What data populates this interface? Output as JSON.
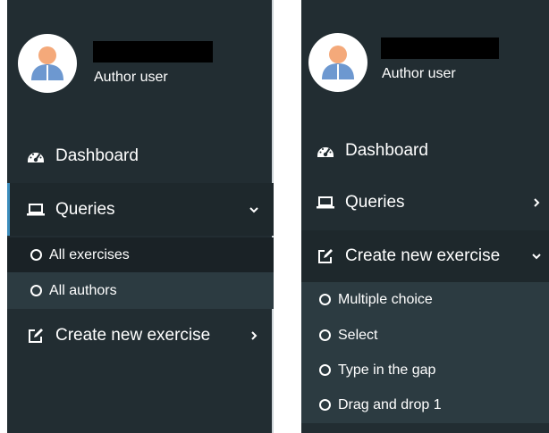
{
  "left_panel": {
    "user": {
      "role": "Author user"
    },
    "nav": {
      "dashboard": "Dashboard",
      "queries": "Queries",
      "queries_children": [
        "All exercises",
        "All authors"
      ],
      "create": "Create new exercise"
    },
    "state": {
      "queries_expanded": true,
      "create_expanded": false
    }
  },
  "right_panel": {
    "user": {
      "role": "Author user"
    },
    "nav": {
      "dashboard": "Dashboard",
      "queries": "Queries",
      "create": "Create new exercise",
      "create_children": [
        "Multiple choice",
        "Select",
        "Type in the gap",
        "Drag and drop 1"
      ]
    },
    "state": {
      "queries_expanded": false,
      "create_expanded": true
    }
  },
  "colors": {
    "sidebar_bg": "#222d32",
    "active_bg": "#1e282c",
    "submenu_bg": "#2c3b41",
    "active_accent": "#3c8dbc"
  }
}
